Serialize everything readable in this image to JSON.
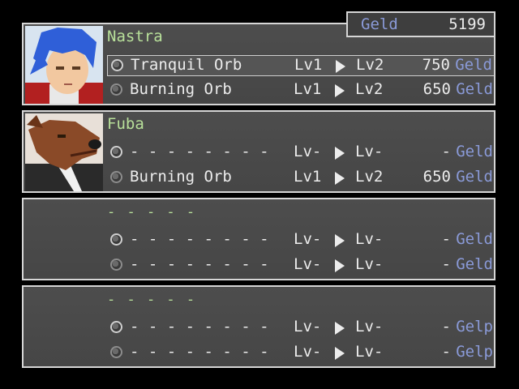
{
  "header": {
    "geld_label": "Geld",
    "geld_amount": "5199"
  },
  "members": [
    {
      "name": "Nastra",
      "rows": [
        {
          "orb": "Tranquil Orb",
          "from": "Lv1",
          "to": "Lv2",
          "cost": "750",
          "unit": "Geld"
        },
        {
          "orb": "Burning Orb",
          "from": "Lv1",
          "to": "Lv2",
          "cost": "650",
          "unit": "Geld"
        }
      ]
    },
    {
      "name": "Fuba",
      "rows": [
        {
          "orb": "- - - - - - - -",
          "from": "Lv-",
          "to": "Lv-",
          "cost": "-",
          "unit": "Geld"
        },
        {
          "orb": "Burning Orb",
          "from": "Lv1",
          "to": "Lv2",
          "cost": "650",
          "unit": "Geld"
        }
      ]
    },
    {
      "name": "- - - - -",
      "rows": [
        {
          "orb": "- - - - - - - -",
          "from": "Lv-",
          "to": "Lv-",
          "cost": "-",
          "unit": "Geld"
        },
        {
          "orb": "- - - - - - - -",
          "from": "Lv-",
          "to": "Lv-",
          "cost": "-",
          "unit": "Geld"
        }
      ]
    },
    {
      "name": "- - - - -",
      "rows": [
        {
          "orb": "- - - - - - - -",
          "from": "Lv-",
          "to": "Lv-",
          "cost": "-",
          "unit": "Gelp"
        },
        {
          "orb": "- - - - - - - -",
          "from": "Lv-",
          "to": "Lv-",
          "cost": "-",
          "unit": "Gelp"
        }
      ]
    }
  ],
  "colors": {
    "panel": "#4a4a4a",
    "border": "#d6d6d6",
    "name_green": "#b8e09a",
    "geld_blue": "#8a9ad8"
  },
  "icons": [
    "orb-icon",
    "arrow-right-icon"
  ]
}
